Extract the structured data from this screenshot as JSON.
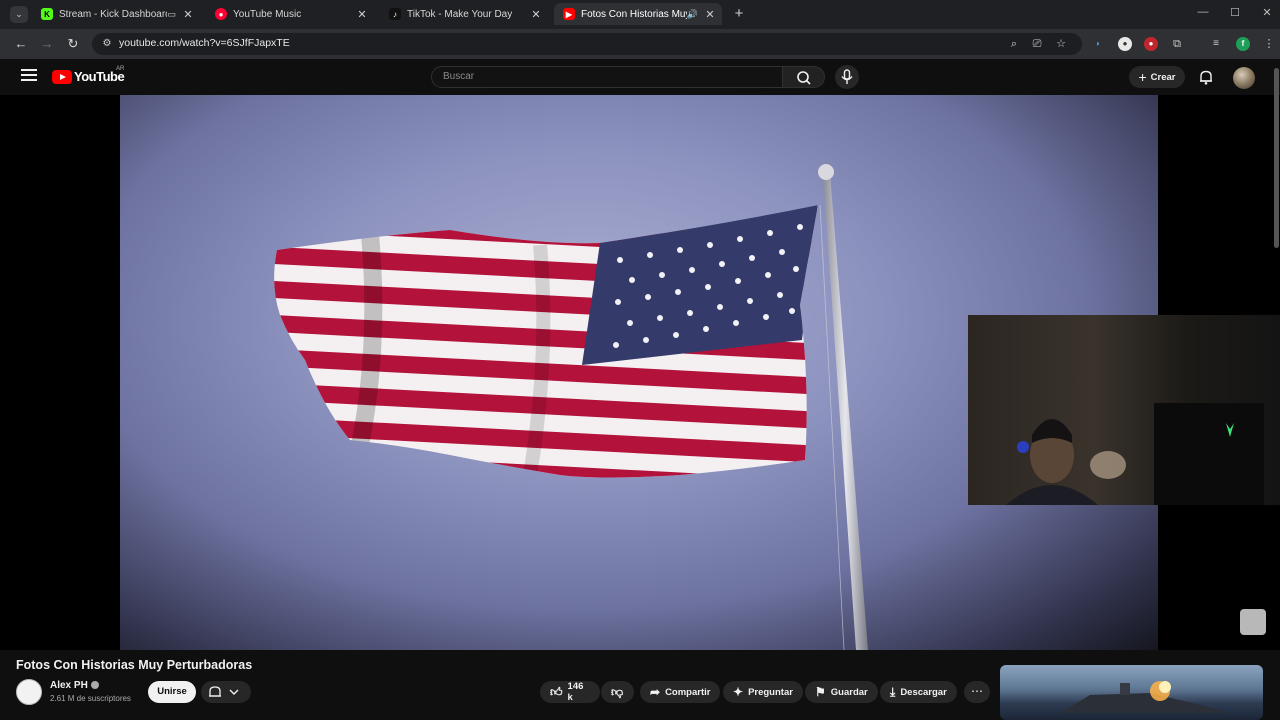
{
  "browser": {
    "tabs": [
      {
        "title": "Stream - Kick Dashboard",
        "favicon": "kick-icon",
        "active": false
      },
      {
        "title": "YouTube Music",
        "favicon": "youtube-music-icon",
        "active": false
      },
      {
        "title": "TikTok - Make Your Day",
        "favicon": "tiktok-icon",
        "active": false
      },
      {
        "title": "Fotos Con Historias Muy Perturbadoras - YouTube",
        "favicon": "youtube-icon",
        "active": true
      }
    ],
    "url": "youtube.com/watch?v=6SJfFJapxTE",
    "profile_initial": "f"
  },
  "youtube": {
    "logo_text": "YouTube",
    "country_code": "AR",
    "search_placeholder": "Buscar",
    "create_label": "Crear"
  },
  "video": {
    "title": "Fotos Con Historias Muy Perturbadoras",
    "channel": "Alex PH",
    "subscribers": "2.61 M de suscriptores",
    "join_label": "Unirse",
    "likes": "146 k",
    "share_label": "Compartir",
    "ask_label": "Preguntar",
    "save_label": "Guardar",
    "download_label": "Descargar"
  },
  "colors": {
    "accent_red": "#ff0000",
    "page_bg": "#0f0f0f",
    "button_bg": "#272727"
  }
}
